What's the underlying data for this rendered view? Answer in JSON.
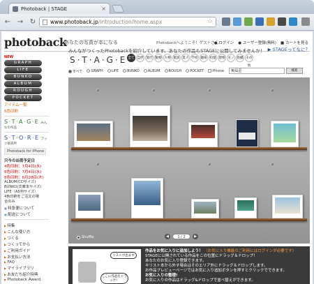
{
  "browser": {
    "tab_title": "Photoback | STAGE",
    "url_domain": "www.photoback.jp",
    "url_path": "/introduction/home.aspx",
    "back_glyph": "←",
    "forward_glyph": "→",
    "reload_glyph": "↻",
    "close_glyph": "×",
    "star_glyph": "☆"
  },
  "header": {
    "logo": "photoback",
    "tagline": "あなたの写真が本になる",
    "welcome": "Photobackへようこそ！ゲストさん",
    "login": "ログイン",
    "register": "ユーザー登録(無料)",
    "cart": "カートを見る"
  },
  "sidebar": {
    "new_badge": "NEW",
    "menu": [
      "GRAPH",
      "LIFE",
      "BUNKO",
      "ALBUM",
      "ROUGH",
      "POCKET"
    ],
    "links_top": [
      "アイテム一覧",
      "6色印刷"
    ],
    "stage_logo": "S·T·A·G·E",
    "stage_note": "みんなの作品",
    "store_logo": "S·T·O·R·E",
    "store_note": "ブック販売所",
    "iphone_banner": "Photoback for iPhone",
    "ship_title": "只今の出荷予定日",
    "ship_lines_red": [
      "4色印刷：7月4日(水)",
      "6色印刷：7月4日(水)"
    ],
    "ship_heading2": "6色印刷：6月28日(木)",
    "ship_lines": [
      "ALBUM(CDサイズ)",
      "BUNKO(文庫本サイズ)",
      "LIFE（A5判サイズ）",
      "4色印刷をご注文の場",
      "合のみ"
    ],
    "square_links": [
      "特急便について",
      "配送について"
    ],
    "bullet_links": [
      "特集",
      "こんな使い方",
      "つくる",
      "つくってから",
      "ご利用ガイド",
      "お支払い方法",
      "FAQ",
      "マイライブラリ",
      "お友だち紹介特典",
      "Photoback Award"
    ]
  },
  "main": {
    "intro": "みんながつくったPhotobackを紹介しています。あなたの作品もSTAGEに公開してみませんか！",
    "what_link": "STAGEってなに？",
    "stage_title": "S·T·A·G·E",
    "categories": [
      "全て",
      "自然",
      "旅行",
      "動物",
      "人物",
      "家族",
      "友人",
      "学校",
      "趣味",
      "料理",
      "建物",
      "モノ",
      "街撮",
      "その他"
    ],
    "active_category": "全て",
    "filters": [
      "すべて",
      "GRAPH",
      "LIFE",
      "BUNKO",
      "ALBUM",
      "ROUGH",
      "POCKET",
      "iPhone"
    ],
    "search_value": "気仙沼",
    "search_button": "検索",
    "shuffle": "Shuffle",
    "pager_current": "1",
    "pager_separator": "/",
    "pager_total": "2",
    "pager_prev": "◀",
    "pager_next": "▶"
  },
  "bottom": {
    "head1": "作品をお気に入りに追加しよう！",
    "head1_note": "（お気に入り機能のご利用にはログインが必要です）",
    "text1": "STAGEに公開されている作品をこの位置にドラッグ＆ドロップ！",
    "text2": "あなたのお気に入り登録できます。",
    "text3": "キリスト本から外す場合はそのエリア外にドラッグ＆ドロップします。",
    "text4": "お作品プレビューページではお気に入り追加ボタンを押すとクリックでできます。",
    "head2": "お気に入りの整理!",
    "text5": "お気に入りの作品はドラッグ&ドロップで並べ替えができます。",
    "speech1": "ここに作品をドラッグ！",
    "speech2": "リストが出ます"
  }
}
